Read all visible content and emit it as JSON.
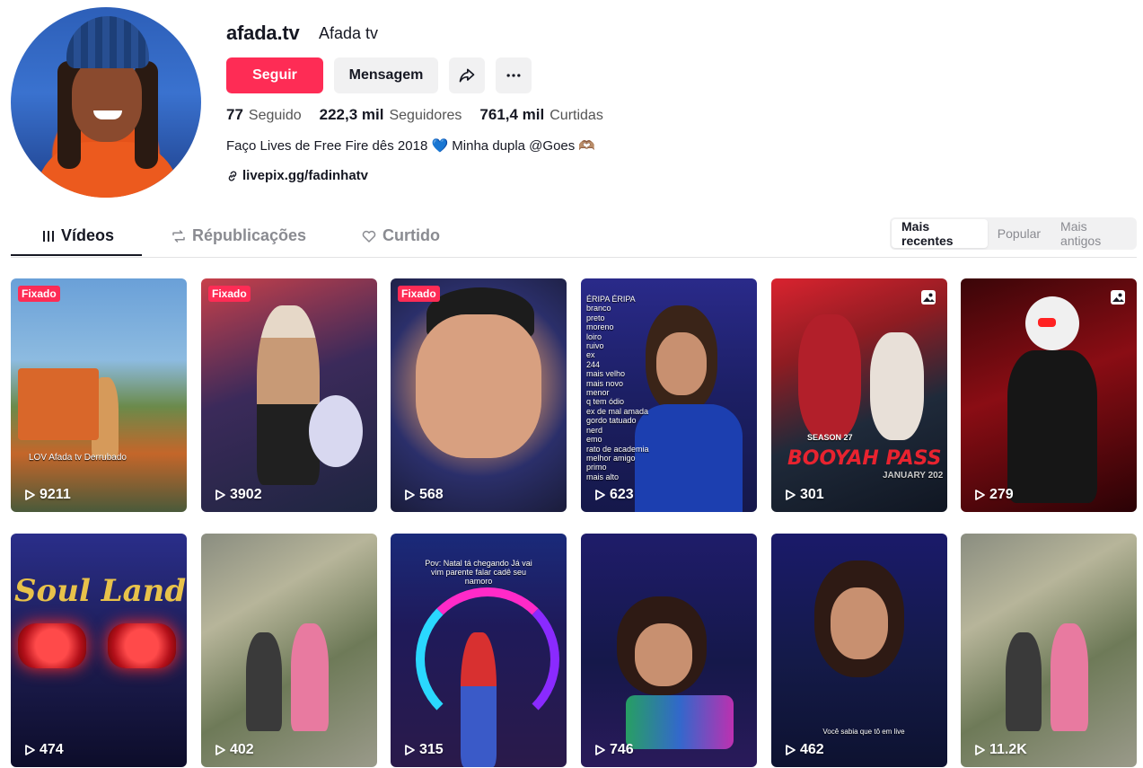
{
  "profile": {
    "username": "afada.tv",
    "nickname": "Afada tv",
    "follow_label": "Seguir",
    "message_label": "Mensagem",
    "stats": [
      {
        "value": "77",
        "label": "Seguido"
      },
      {
        "value": "222,3 mil",
        "label": "Seguidores"
      },
      {
        "value": "761,4 mil",
        "label": "Curtidas"
      }
    ],
    "bio": "Faço Lives de Free Fire dês 2018 💙 Minha dupla @Goes 🫶🏽",
    "link": "livepix.gg/fadinhatv"
  },
  "tabs": [
    {
      "label": "Vídeos",
      "icon": "grid-icon",
      "active": true
    },
    {
      "label": "Républicações",
      "icon": "repost-icon",
      "active": false
    },
    {
      "label": "Curtido",
      "icon": "heart-outline-icon",
      "active": false
    }
  ],
  "sort": [
    {
      "label": "Mais recentes",
      "active": true
    },
    {
      "label": "Popular",
      "active": false
    },
    {
      "label": "Mais antigos",
      "active": false
    }
  ],
  "pinned_label": "Fixado",
  "videos": [
    {
      "views": "9211",
      "pinned": true,
      "type": "video"
    },
    {
      "views": "3902",
      "pinned": true,
      "type": "video"
    },
    {
      "views": "568",
      "pinned": true,
      "type": "video"
    },
    {
      "views": "623",
      "pinned": false,
      "type": "video"
    },
    {
      "views": "301",
      "pinned": false,
      "type": "photo"
    },
    {
      "views": "279",
      "pinned": false,
      "type": "photo"
    },
    {
      "views": "474",
      "pinned": false,
      "type": "video"
    },
    {
      "views": "402",
      "pinned": false,
      "type": "video"
    },
    {
      "views": "315",
      "pinned": false,
      "type": "video"
    },
    {
      "views": "746",
      "pinned": false,
      "type": "video"
    },
    {
      "views": "462",
      "pinned": false,
      "type": "video"
    },
    {
      "views": "11.2K",
      "pinned": false,
      "type": "video"
    }
  ],
  "thumb_text": {
    "c4_header": "ÉRIPA ÉRIPA",
    "c4_list": [
      "branco",
      "preto",
      "moreno",
      "loiro",
      "ruivo",
      "ex",
      "244",
      "mais velho",
      "mais novo",
      "menor",
      "q tem ódio",
      "ex de mal amada",
      "gordo tatuado",
      "nerd",
      "emo",
      "rato de academia",
      "melhor amigo",
      "primo",
      "mais alto"
    ],
    "c5_title": "BOOYAH PASS",
    "c5_season": "SEASON 27",
    "c5_date": "JANUARY 202",
    "c7_title": "Soul Land",
    "c9_caption": "Pov: Natal tá chegando Já vai vim parente falar cadê seu namoro",
    "c11_caption": "Você sabia que tô em live",
    "c1_overlay": "LOV   Afada tv  Derrubado"
  }
}
